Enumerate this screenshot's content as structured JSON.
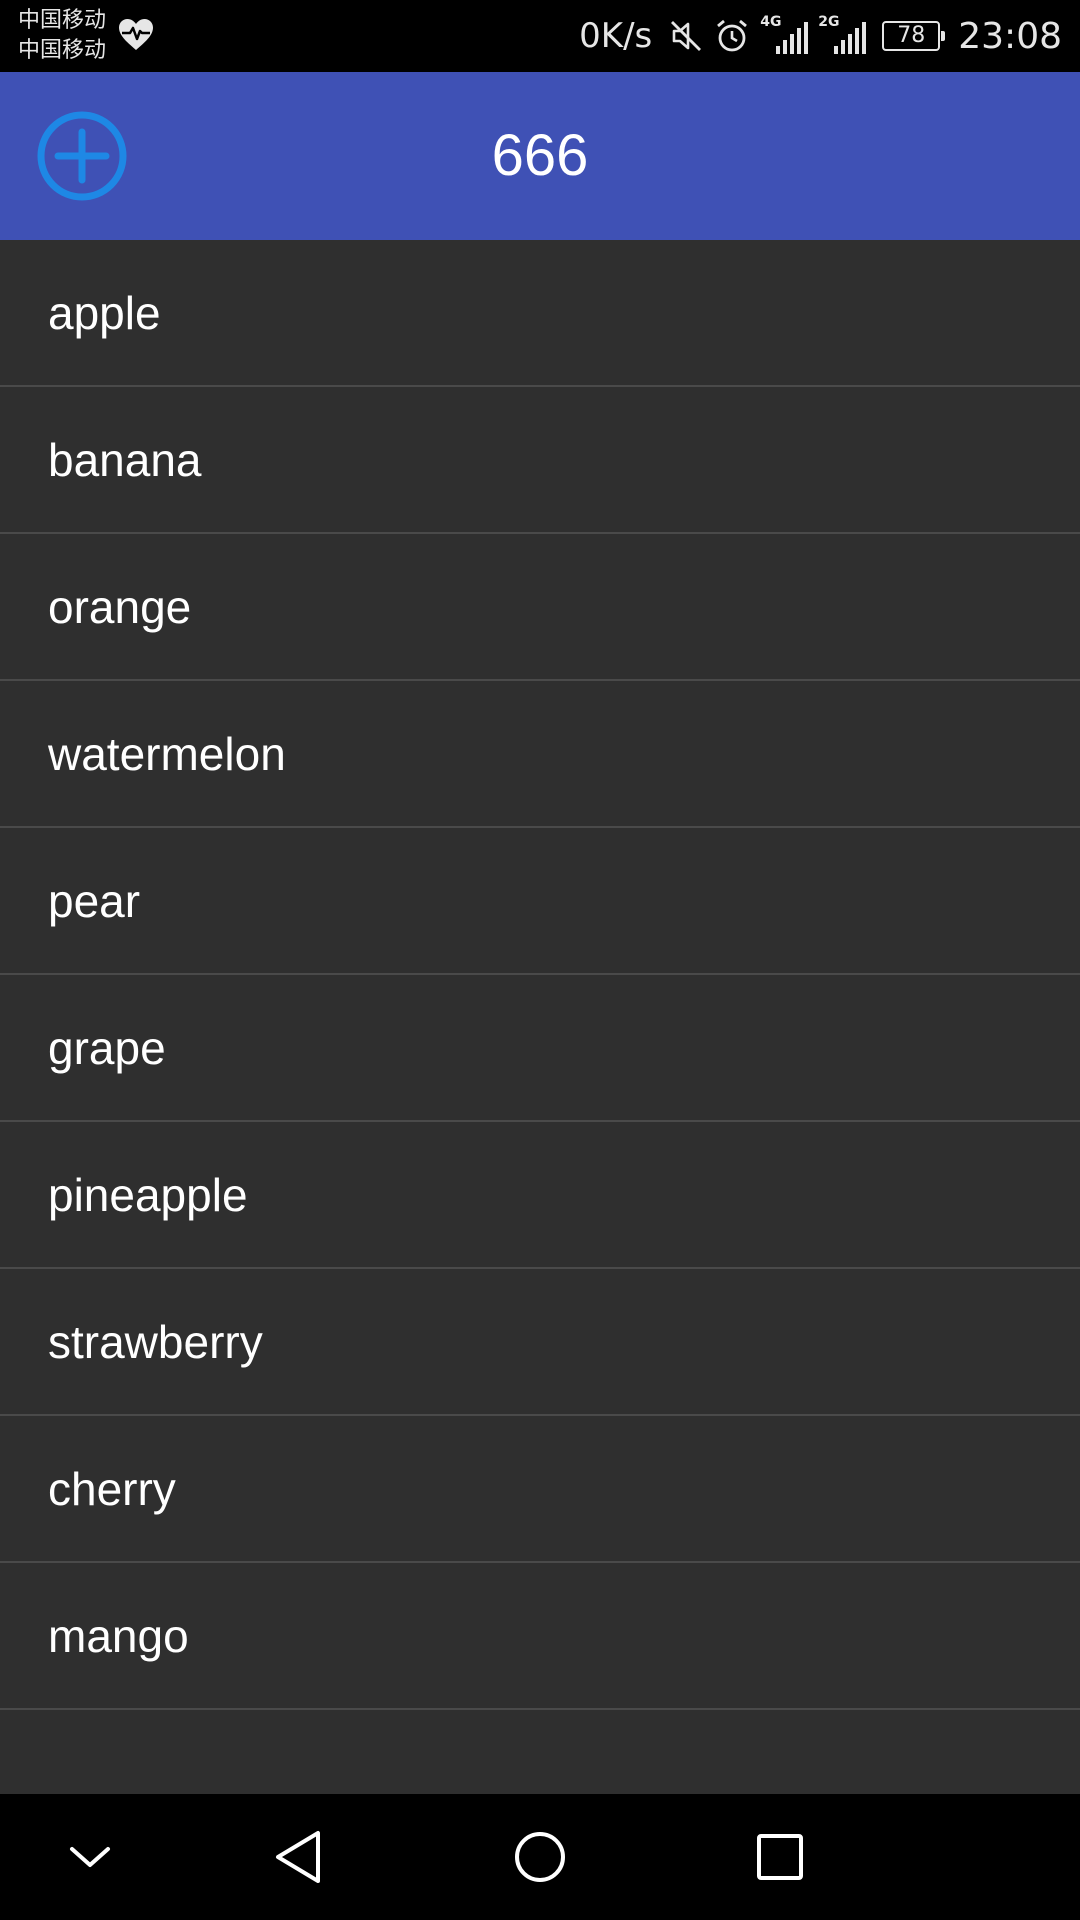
{
  "status_bar": {
    "carrier_1": "中国移动",
    "carrier_2": "中国移动",
    "net_speed": "0K/s",
    "network_1": "4G",
    "network_2": "2G",
    "battery_level": "78",
    "time": "23:08",
    "icons": [
      "heart-rate-icon",
      "mute-icon",
      "alarm-icon",
      "signal-4g-icon",
      "signal-2g-icon",
      "battery-icon"
    ]
  },
  "app_bar": {
    "title": "666",
    "color": "#3f51b5",
    "add_icon": "add-circle-icon",
    "add_icon_color": "#1e88e5"
  },
  "list": {
    "items": [
      {
        "label": "apple"
      },
      {
        "label": "banana"
      },
      {
        "label": "orange"
      },
      {
        "label": "watermelon"
      },
      {
        "label": "pear"
      },
      {
        "label": "grape"
      },
      {
        "label": "pineapple"
      },
      {
        "label": "strawberry"
      },
      {
        "label": "cherry"
      },
      {
        "label": "mango"
      },
      {
        "label": ""
      }
    ]
  },
  "nav_bar": {
    "icons": [
      "chevron-down-icon",
      "back-icon",
      "home-icon",
      "recents-icon"
    ]
  }
}
